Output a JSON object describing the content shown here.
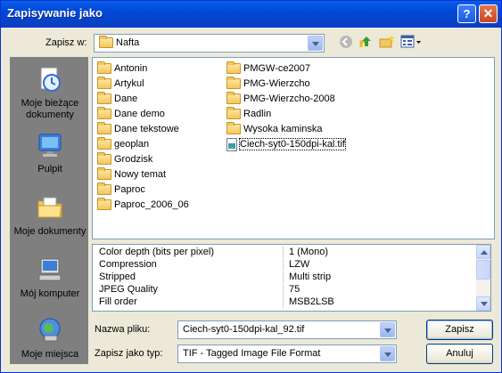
{
  "window": {
    "title": "Zapisywanie jako"
  },
  "save_in": {
    "label": "Zapisz w:",
    "value": "Nafta"
  },
  "places": [
    {
      "label": "Moje bieżące dokumenty",
      "icon": "recent-documents-icon"
    },
    {
      "label": "Pulpit",
      "icon": "desktop-icon"
    },
    {
      "label": "Moje dokumenty",
      "icon": "my-documents-icon"
    },
    {
      "label": "Mój komputer",
      "icon": "my-computer-icon"
    },
    {
      "label": "Moje miejsca",
      "icon": "network-places-icon"
    }
  ],
  "files": {
    "col1": [
      "Antonin",
      "Artykul",
      "Dane",
      "Dane demo",
      "Dane tekstowe",
      "geoplan",
      "Grodzisk",
      "Nowy temat",
      "Paproc",
      "Paproc_2006_06"
    ],
    "col2": [
      "PMGW-ce2007",
      "PMG-Wierzcho",
      "PMG-Wierzcho-2008",
      "Radlin",
      "Wysoka kaminska"
    ],
    "tif_file": "Ciech-syt0-150dpi-kal.tif"
  },
  "properties": [
    {
      "key": "Color depth (bits per pixel)",
      "value": "1 (Mono)"
    },
    {
      "key": "Compression",
      "value": "LZW"
    },
    {
      "key": "Stripped",
      "value": "Multi strip"
    },
    {
      "key": "JPEG Quality",
      "value": "75"
    },
    {
      "key": "Fill order",
      "value": "MSB2LSB"
    }
  ],
  "filename": {
    "label": "Nazwa pliku:",
    "value": "Ciech-syt0-150dpi-kal_92.tif"
  },
  "filetype": {
    "label": "Zapisz jako typ:",
    "value": "TIF - Tagged Image File Format"
  },
  "buttons": {
    "save": "Zapisz",
    "cancel": "Anuluj"
  },
  "colors": {
    "titlebar": "#0a5fe8",
    "dialog_bg": "#ece9d8",
    "places_bg": "#7f7f7f"
  }
}
